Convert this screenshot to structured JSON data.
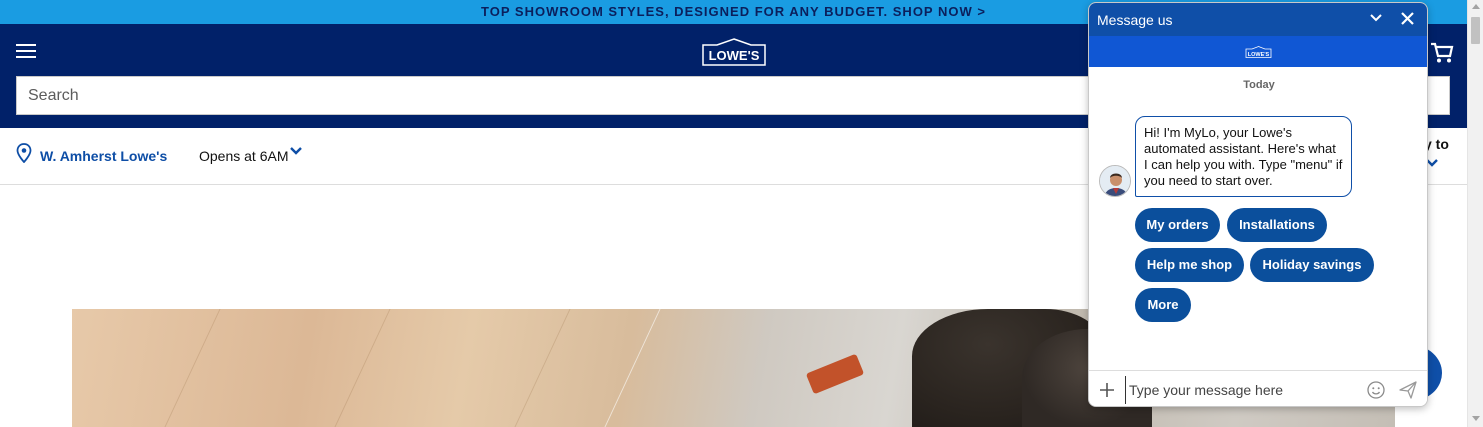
{
  "promo": {
    "text": "TOP SHOWROOM STYLES, DESIGNED FOR ANY BUDGET. SHOP NOW >"
  },
  "header": {
    "logo_text": "LOWE'S",
    "search_placeholder": "Search"
  },
  "store": {
    "name": "W. Amherst Lowe's",
    "hours": "Opens at 6AM",
    "delivery_label": "y to"
  },
  "chat": {
    "title": "Message us",
    "brand_logo_text": "LOWE'S",
    "date_label": "Today",
    "greeting": "Hi! I'm MyLo, your Lowe's automated assistant. Here's what I can help you with. Type \"menu\" if you need to start over.",
    "quick_replies": [
      "My orders",
      "Installations",
      "Help me shop",
      "Holiday savings",
      "More"
    ],
    "input_placeholder": "Type your message here"
  },
  "colors": {
    "navy": "#012169",
    "promo_blue": "#1a9ce2",
    "chat_blue": "#0f4fa8",
    "button_blue": "#0b4f9c"
  }
}
